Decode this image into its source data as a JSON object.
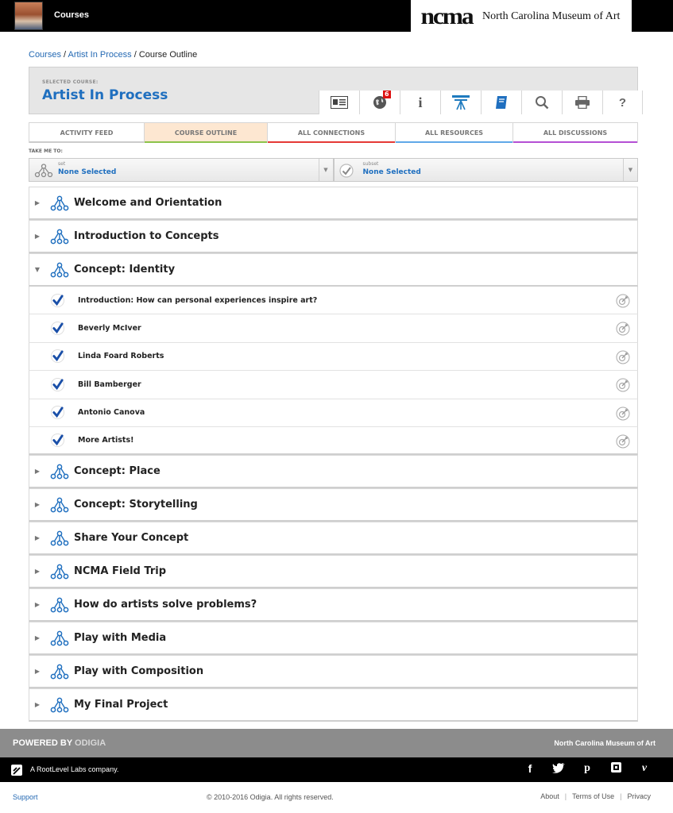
{
  "topbar": {
    "courses_label": "Courses",
    "brand_logo": "ncma",
    "brand_name": "North Carolina Museum of Art"
  },
  "breadcrumb": {
    "items": [
      "Courses",
      "Artist In Process"
    ],
    "current": "Course Outline",
    "separator": "/"
  },
  "course": {
    "selected_label": "SELECTED COURSE:",
    "title": "Artist In Process"
  },
  "toolbar": [
    {
      "icon": "id-card-icon"
    },
    {
      "icon": "globe-icon",
      "badge": "6"
    },
    {
      "icon": "info-icon"
    },
    {
      "icon": "easel-icon"
    },
    {
      "icon": "book-icon"
    },
    {
      "icon": "search-icon"
    },
    {
      "icon": "print-icon"
    },
    {
      "icon": "help-icon"
    }
  ],
  "tabs": [
    {
      "label": "ACTIVITY FEED",
      "color": "#cccccc"
    },
    {
      "label": "COURSE OUTLINE",
      "color": "#8bc34a",
      "active": true
    },
    {
      "label": "ALL CONNECTIONS",
      "color": "#e53935"
    },
    {
      "label": "ALL RESOURCES",
      "color": "#5fa8e8"
    },
    {
      "label": "ALL DISCUSSIONS",
      "color": "#b44fd4"
    }
  ],
  "takeme": {
    "label": "TAKE ME TO:"
  },
  "selects": {
    "set": {
      "small": "set",
      "value": "None Selected"
    },
    "subset": {
      "small": "subset",
      "value": "None Selected"
    }
  },
  "outline": {
    "sections_before": [
      {
        "title": "Welcome and Orientation"
      },
      {
        "title": "Introduction to Concepts"
      }
    ],
    "expanded": {
      "title": "Concept: Identity",
      "lessons": [
        "Introduction: How can personal experiences inspire art?",
        "Beverly McIver",
        "Linda Foard Roberts",
        "Bill Bamberger",
        "Antonio Canova",
        "More Artists!"
      ]
    },
    "sections_after": [
      {
        "title": "Concept: Place"
      },
      {
        "title": "Concept: Storytelling"
      },
      {
        "title": "Share Your Concept"
      },
      {
        "title": "NCMA Field Trip"
      },
      {
        "title": "How do artists solve problems?"
      },
      {
        "title": "Play with Media"
      },
      {
        "title": "Play with Composition"
      },
      {
        "title": "My Final Project"
      }
    ]
  },
  "footer": {
    "powered_prefix": "POWERED BY",
    "powered_brand": "ODIGIA",
    "ncma": "North Carolina Museum of Art",
    "rootlevel": "A RootLevel Labs company.",
    "social": [
      {
        "icon": "facebook-icon",
        "glyph": "f"
      },
      {
        "icon": "twitter-icon",
        "glyph": "t"
      },
      {
        "icon": "pinterest-icon",
        "glyph": "p"
      },
      {
        "icon": "instagram-icon",
        "glyph": "◘"
      },
      {
        "icon": "vimeo-icon",
        "glyph": "v"
      }
    ],
    "support": "Support",
    "copyright": "© 2010-2016 Odigia. All rights reserved.",
    "links": [
      "About",
      "Terms of Use",
      "Privacy"
    ]
  },
  "colors": {
    "accent_blue": "#1f6fbf",
    "link_blue": "#2469b3",
    "badge_red": "#dd1111"
  }
}
